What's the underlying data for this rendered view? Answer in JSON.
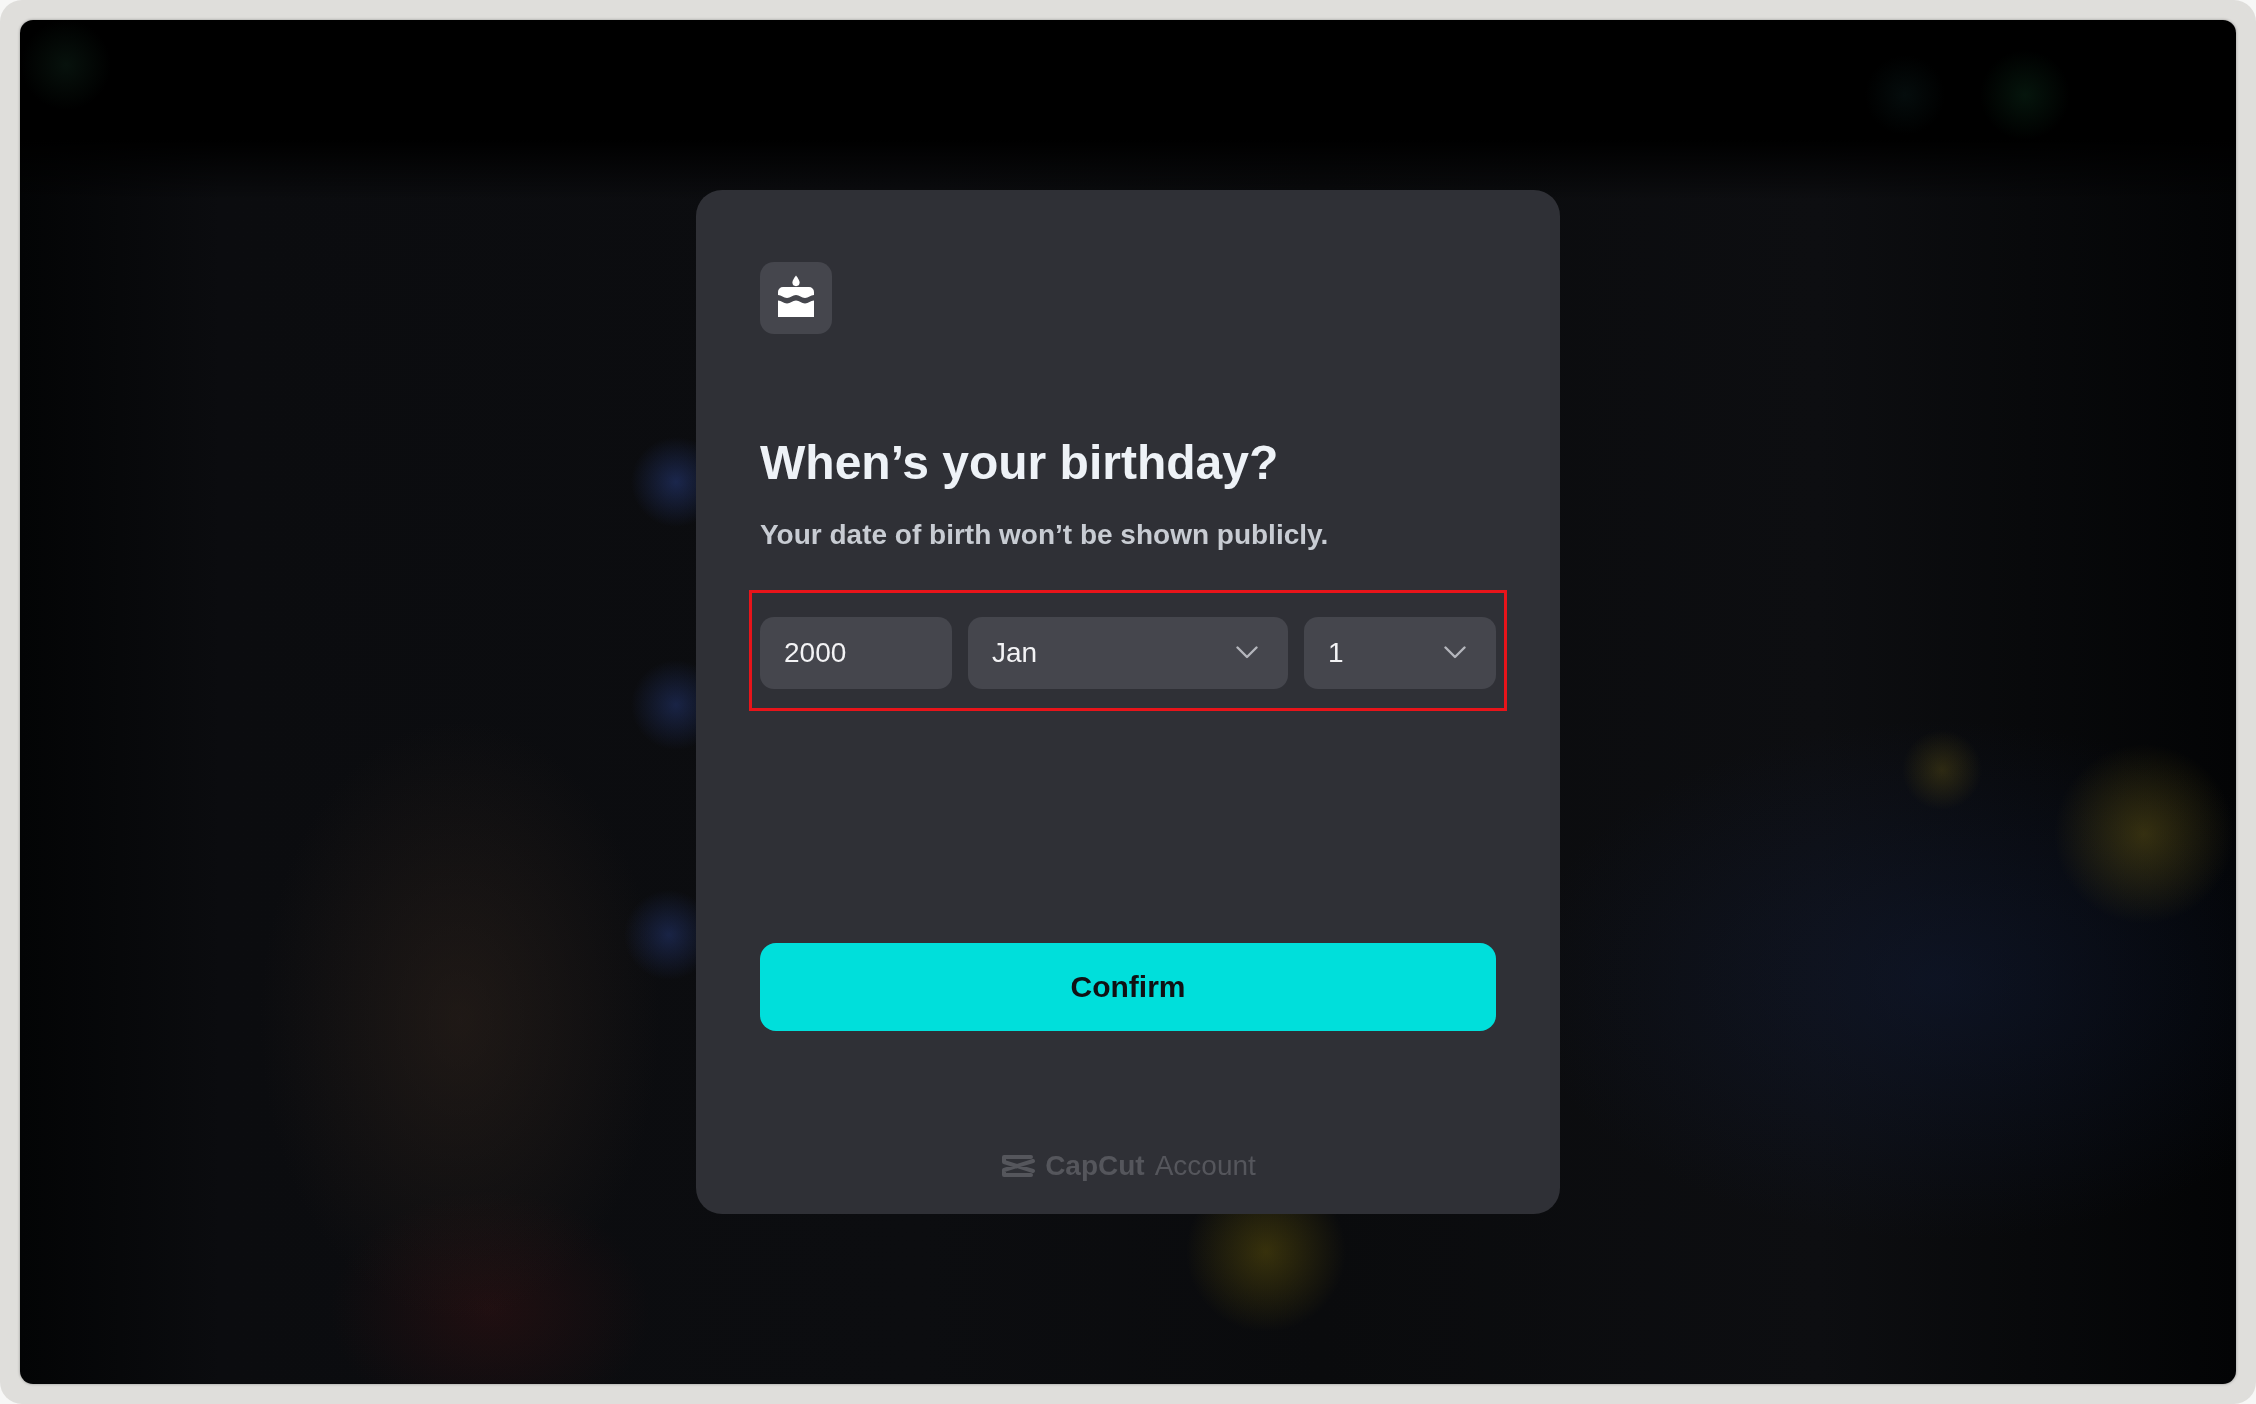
{
  "dialog": {
    "title": "When’s your birthday?",
    "subtitle": "Your date of birth won’t be shown publicly.",
    "date_fields": {
      "highlighted": true,
      "fields": [
        {
          "kind": "input",
          "value": "2000"
        },
        {
          "kind": "dropdown",
          "value": "Jan"
        },
        {
          "kind": "dropdown",
          "value": "1"
        }
      ]
    },
    "confirm_button": "Confirm",
    "footer": {
      "brand": "CapCut",
      "label": "Account"
    }
  }
}
